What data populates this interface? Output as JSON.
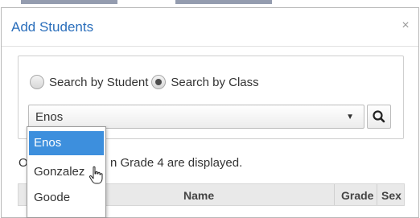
{
  "dialog": {
    "title": "Add Students",
    "close_glyph": "×"
  },
  "search_mode": {
    "options": [
      {
        "label": "Search by Student",
        "checked": false
      },
      {
        "label": "Search by Class",
        "checked": true
      }
    ]
  },
  "class_select": {
    "value": "Enos",
    "caret": "▼",
    "search_icon": "magnifier-icon"
  },
  "dropdown": {
    "options": [
      "Enos",
      "Gonzalez",
      "Goode"
    ],
    "selected": "Enos",
    "hovered": "Gonzalez"
  },
  "info": {
    "lead": "O",
    "rest": "n Grade 4 are displayed."
  },
  "table": {
    "columns": [
      "Name",
      "Grade",
      "Sex"
    ]
  },
  "colors": {
    "title": "#2a6ebb",
    "selected_item": "#3d8fdd",
    "header_bg": "#e9e9e9"
  }
}
